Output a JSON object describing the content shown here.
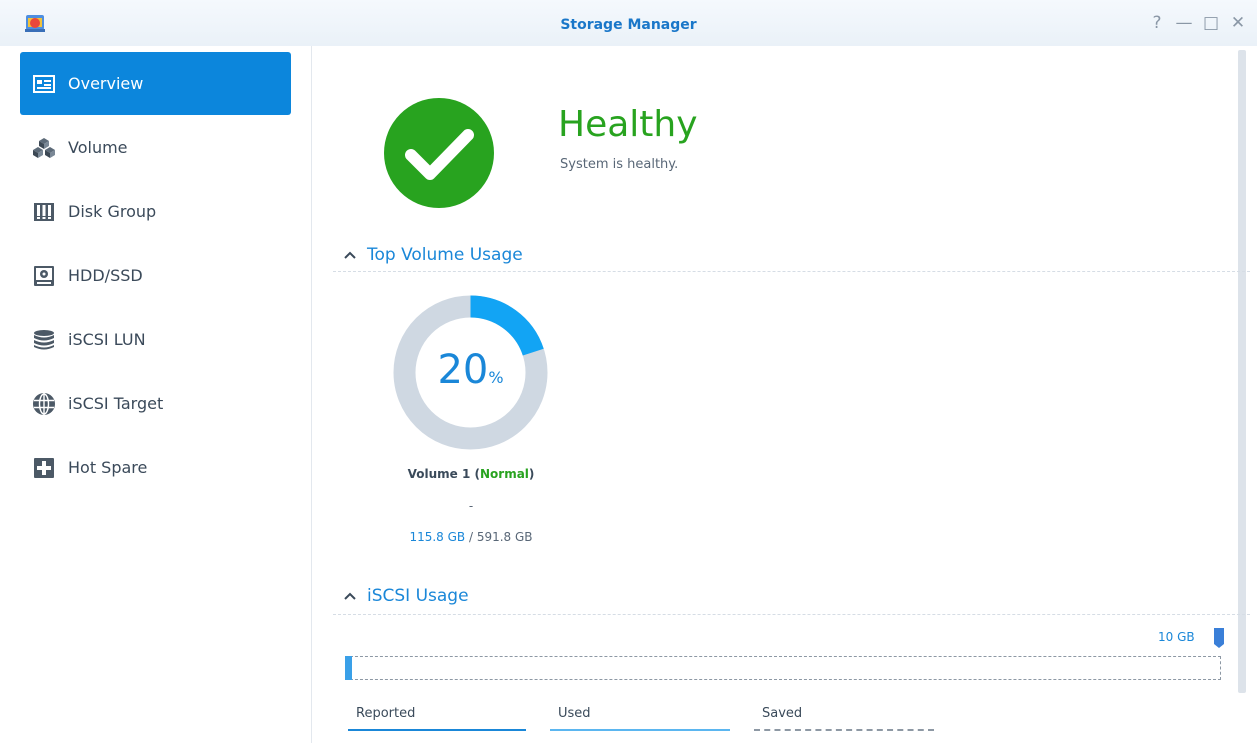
{
  "window": {
    "title": "Storage Manager",
    "help_glyph": "?",
    "minimize_glyph": "—",
    "maximize_glyph": "□",
    "close_glyph": "✕"
  },
  "sidebar": {
    "items": [
      {
        "label": "Overview",
        "icon": "overview-icon",
        "active": true
      },
      {
        "label": "Volume",
        "icon": "volume-icon"
      },
      {
        "label": "Disk Group",
        "icon": "disk-group-icon"
      },
      {
        "label": "HDD/SSD",
        "icon": "hdd-icon"
      },
      {
        "label": "iSCSI LUN",
        "icon": "lun-icon"
      },
      {
        "label": "iSCSI Target",
        "icon": "globe-icon"
      },
      {
        "label": "Hot Spare",
        "icon": "plus-box-icon"
      }
    ]
  },
  "health": {
    "status": "Healthy",
    "message": "System is healthy."
  },
  "top_volume": {
    "heading": "Top Volume Usage",
    "percent": "20",
    "percent_unit": "%",
    "usage_fraction": 0.2,
    "volume_name": "Volume 1",
    "status_open": " (",
    "status": "Normal",
    "status_close": ")",
    "detail": "-",
    "used": "115.8 GB",
    "separator": " / ",
    "total": "591.8 GB"
  },
  "iscsi": {
    "heading": "iSCSI Usage",
    "capacity": "10 GB",
    "usage_fraction": 0.008,
    "legend": [
      "Reported",
      "Used",
      "Saved"
    ]
  },
  "colors": {
    "accent": "#0c86dc",
    "healthy_green": "#28a31f",
    "donut_track": "#cfd8e2",
    "donut_fill": "#12a4f4"
  }
}
